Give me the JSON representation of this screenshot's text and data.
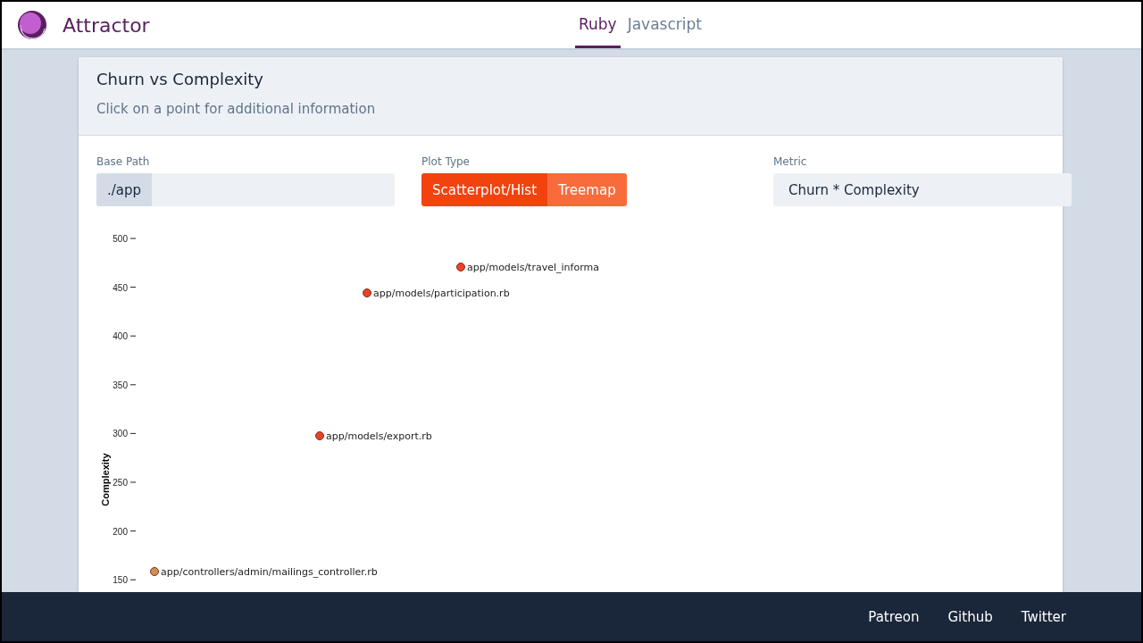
{
  "header": {
    "title": "Attractor",
    "tabs": [
      {
        "label": "Ruby",
        "selected": true
      },
      {
        "label": "Javascript",
        "selected": false
      }
    ]
  },
  "card": {
    "title": "Churn vs Complexity",
    "subtitle": "Click on a point for additional information",
    "base_path": {
      "label": "Base Path",
      "prefix": "./app"
    },
    "plot_type": {
      "label": "Plot Type",
      "options": [
        {
          "label": "Scatterplot/Hist",
          "selected": true
        },
        {
          "label": "Treemap",
          "selected": false
        }
      ]
    },
    "metric": {
      "label": "Metric",
      "value": "Churn * Complexity"
    },
    "scatter_plot": {
      "y_axis_title": "Complexity",
      "y_tick_labels": [
        "500",
        "450",
        "400",
        "350",
        "300",
        "250",
        "200",
        "150"
      ],
      "points": [
        {
          "label": "app/models/travel_informa",
          "color": "#e8432a"
        },
        {
          "label": "app/models/participation.rb",
          "color": "#e8432a"
        },
        {
          "label": "app/models/export.rb",
          "color": "#e8432a"
        },
        {
          "label": "app/controllers/admin/mailings_controller.rb",
          "color": "#c8935a"
        }
      ]
    }
  },
  "footer": {
    "links": [
      "Patreon",
      "Github",
      "Twitter"
    ]
  }
}
